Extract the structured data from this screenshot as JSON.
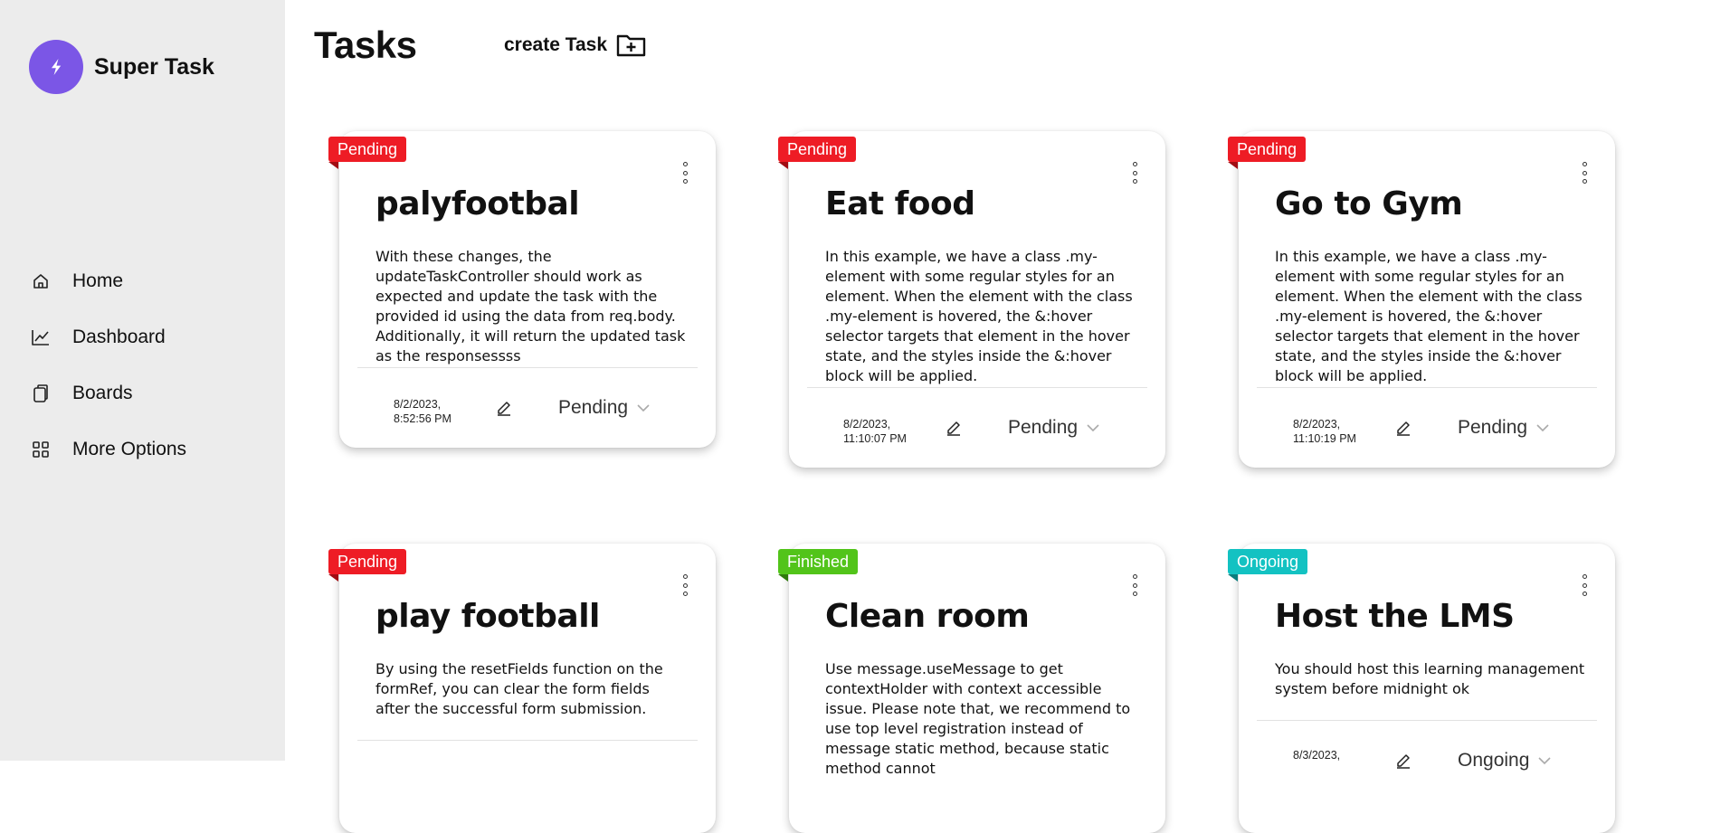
{
  "app": {
    "name": "Super Task"
  },
  "sidebar": {
    "items": [
      {
        "label": "Home",
        "icon": "home-icon"
      },
      {
        "label": "Dashboard",
        "icon": "chart-icon"
      },
      {
        "label": "Boards",
        "icon": "boards-icon"
      },
      {
        "label": "More Options",
        "icon": "grid-icon"
      }
    ]
  },
  "header": {
    "title": "Tasks",
    "create_label": "create Task"
  },
  "colors": {
    "accent": "#7b56e6",
    "pending": "#ee1c25",
    "finished": "#52c41a",
    "ongoing": "#13c2c2"
  },
  "tasks": [
    {
      "status": "Pending",
      "title": "palyfootbal",
      "description": "With these changes, the updateTaskController should work as expected and update the task with the provided id using the data from req.body. Additionally, it will return the updated task as the responsessss",
      "date_line1": "8/2/2023,",
      "date_line2": "8:52:56 PM",
      "select_value": "Pending"
    },
    {
      "status": "Pending",
      "title": "Eat food",
      "description": "In this example, we have a class .my-element with some regular styles for an element. When the element with the class .my-element is hovered, the &:hover selector targets that element in the hover state, and the styles inside the &:hover block will be applied.",
      "date_line1": "8/2/2023,",
      "date_line2": "11:10:07 PM",
      "select_value": "Pending"
    },
    {
      "status": "Pending",
      "title": "Go to Gym",
      "description": "In this example, we have a class .my-element with some regular styles for an element. When the element with the class .my-element is hovered, the &:hover selector targets that element in the hover state, and the styles inside the &:hover block will be applied.",
      "date_line1": "8/2/2023,",
      "date_line2": "11:10:19 PM",
      "select_value": "Pending"
    },
    {
      "status": "Pending",
      "title": "play football",
      "description": "By using the resetFields function on the formRef, you can clear the form fields after the successful form submission.",
      "date_line1": "",
      "date_line2": "",
      "select_value": ""
    },
    {
      "status": "Finished",
      "title": "Clean room",
      "description": "Use message.useMessage to get contextHolder with context accessible issue. Please note that, we recommend to use top level registration instead of message static method, because static method cannot",
      "date_line1": "",
      "date_line2": "",
      "select_value": ""
    },
    {
      "status": "Ongoing",
      "title": "Host the LMS",
      "description": "You should host this learning management system before midnight ok",
      "date_line1": "8/3/2023,",
      "date_line2": "",
      "select_value": "Ongoing"
    }
  ]
}
